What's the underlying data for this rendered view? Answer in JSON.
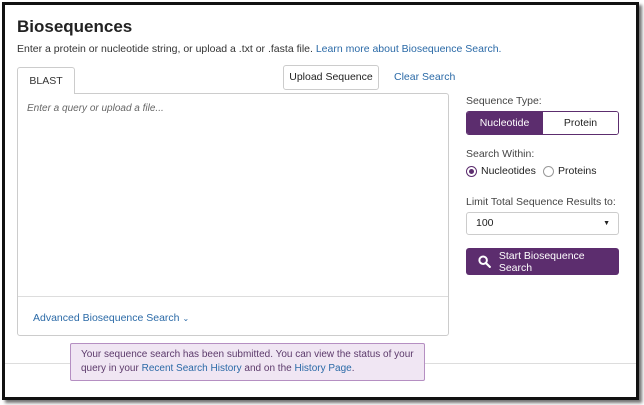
{
  "header": {
    "title": "Biosequences",
    "subtitle_text": "Enter a protein or nucleotide string, or upload a .txt or .fasta file.",
    "learn_more_link": "Learn more about Biosequence Search."
  },
  "query": {
    "tab_label": "BLAST",
    "upload_button": "Upload Sequence",
    "clear_link": "Clear Search",
    "placeholder": "Enter a query or upload a file...",
    "advanced_link": "Advanced Biosequence Search"
  },
  "options": {
    "sequence_type_label": "Sequence Type:",
    "sequence_types": [
      "Nucleotide",
      "Protein"
    ],
    "selected_sequence_type": "Nucleotide",
    "search_within_label": "Search Within:",
    "search_within_options": [
      "Nucleotides",
      "Proteins"
    ],
    "selected_search_within": "Nucleotides",
    "limit_label": "Limit Total Sequence Results to:",
    "limit_value": "100",
    "start_button": "Start Biosequence Search"
  },
  "toast": {
    "text_1": "Your sequence search has been submitted. You can view the status of your query in your",
    "link_1": "Recent Search History",
    "text_2": "and on the",
    "link_2": "History Page",
    "text_3": "."
  },
  "colors": {
    "accent": "#5c2d6e",
    "link": "#2b6aa7",
    "toast_bg": "#f0e6f3"
  },
  "icons": {
    "search": "search-icon",
    "dropdown": "caret-down-icon",
    "advanced": "chevron-down-icon"
  }
}
